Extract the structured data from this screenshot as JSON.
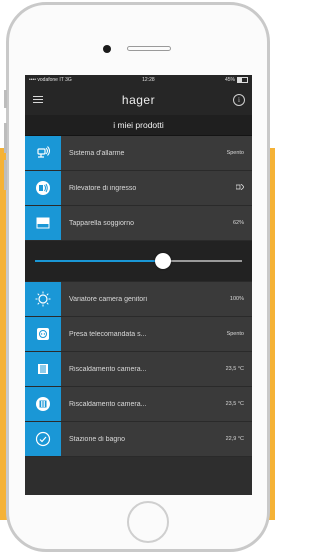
{
  "statusbar": {
    "carrier": "•••• vodafone IT  3G",
    "time": "12:28",
    "battery": "45%"
  },
  "navbar": {
    "title": "hager",
    "menu_icon": "menu-icon",
    "info_icon": "info-icon"
  },
  "section": {
    "title": "i miei prodotti"
  },
  "products": [
    {
      "label": "Sistema d'allarme",
      "value": "Spento",
      "icon": "alarm-system-icon"
    },
    {
      "label": "Rilevatore di ingresso",
      "value": "",
      "icon": "entry-detector-icon"
    },
    {
      "label": "Tapparella soggiorno",
      "value": "62%",
      "icon": "shutter-icon"
    },
    {
      "label": "Variatore camera genitori",
      "value": "100%",
      "icon": "dimmer-icon"
    },
    {
      "label": "Presa telecomandata s...",
      "value": "Spento",
      "icon": "remote-socket-icon"
    },
    {
      "label": "Riscaldamento camera...",
      "value": "23,5 °C",
      "icon": "heating-icon"
    },
    {
      "label": "Riscaldamento camera...",
      "value": "23,5 °C",
      "icon": "heating-icon"
    },
    {
      "label": "Stazione di bagno",
      "value": "22,9 °C",
      "icon": "bathroom-station-icon"
    }
  ],
  "slider": {
    "value": 0.62
  },
  "colors": {
    "accent": "#1a97d6",
    "background": "#f5b236",
    "list_bg": "#3a3a3a"
  }
}
